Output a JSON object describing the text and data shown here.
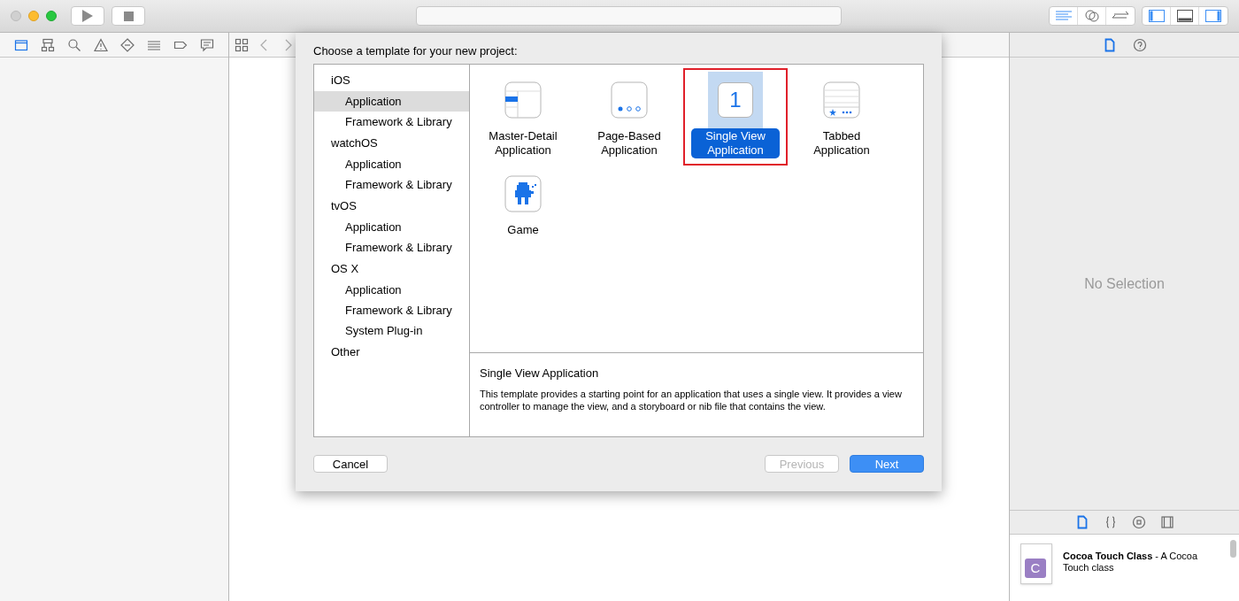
{
  "dialog": {
    "title": "Choose a template for your new project:",
    "categories": [
      {
        "label": "iOS",
        "children": [
          {
            "label": "Application",
            "selected": true
          },
          {
            "label": "Framework & Library",
            "selected": false
          }
        ]
      },
      {
        "label": "watchOS",
        "children": [
          {
            "label": "Application",
            "selected": false
          },
          {
            "label": "Framework & Library",
            "selected": false
          }
        ]
      },
      {
        "label": "tvOS",
        "children": [
          {
            "label": "Application",
            "selected": false
          },
          {
            "label": "Framework & Library",
            "selected": false
          }
        ]
      },
      {
        "label": "OS X",
        "children": [
          {
            "label": "Application",
            "selected": false
          },
          {
            "label": "Framework & Library",
            "selected": false
          },
          {
            "label": "System Plug-in",
            "selected": false
          }
        ]
      },
      {
        "label": "Other"
      }
    ],
    "templates": [
      {
        "kind": "master-detail",
        "label": "Master-Detail Application",
        "selected": false,
        "highlighted": false
      },
      {
        "kind": "page-based",
        "label": "Page-Based Application",
        "selected": false,
        "highlighted": false
      },
      {
        "kind": "single-view",
        "label": "Single View Application",
        "icon_text": "1",
        "selected": true,
        "highlighted": true
      },
      {
        "kind": "tabbed",
        "label": "Tabbed Application",
        "selected": false,
        "highlighted": false
      },
      {
        "kind": "game",
        "label": "Game",
        "selected": false,
        "highlighted": false
      }
    ],
    "description": {
      "title": "Single View Application",
      "text": "This template provides a starting point for an application that uses a single view. It provides a view controller to manage the view, and a storyboard or nib file that contains the view."
    },
    "buttons": [
      {
        "label": "Cancel",
        "kind": "cancel",
        "disabled": false
      },
      {
        "label": "Previous",
        "kind": "nav",
        "disabled": true
      },
      {
        "label": "Next",
        "kind": "default",
        "disabled": false
      }
    ]
  },
  "inspector": {
    "empty_text": "No Selection"
  },
  "library": {
    "items": [
      {
        "title": "Cocoa Touch Class",
        "description": "- A Cocoa Touch class",
        "badge": "C"
      }
    ]
  }
}
